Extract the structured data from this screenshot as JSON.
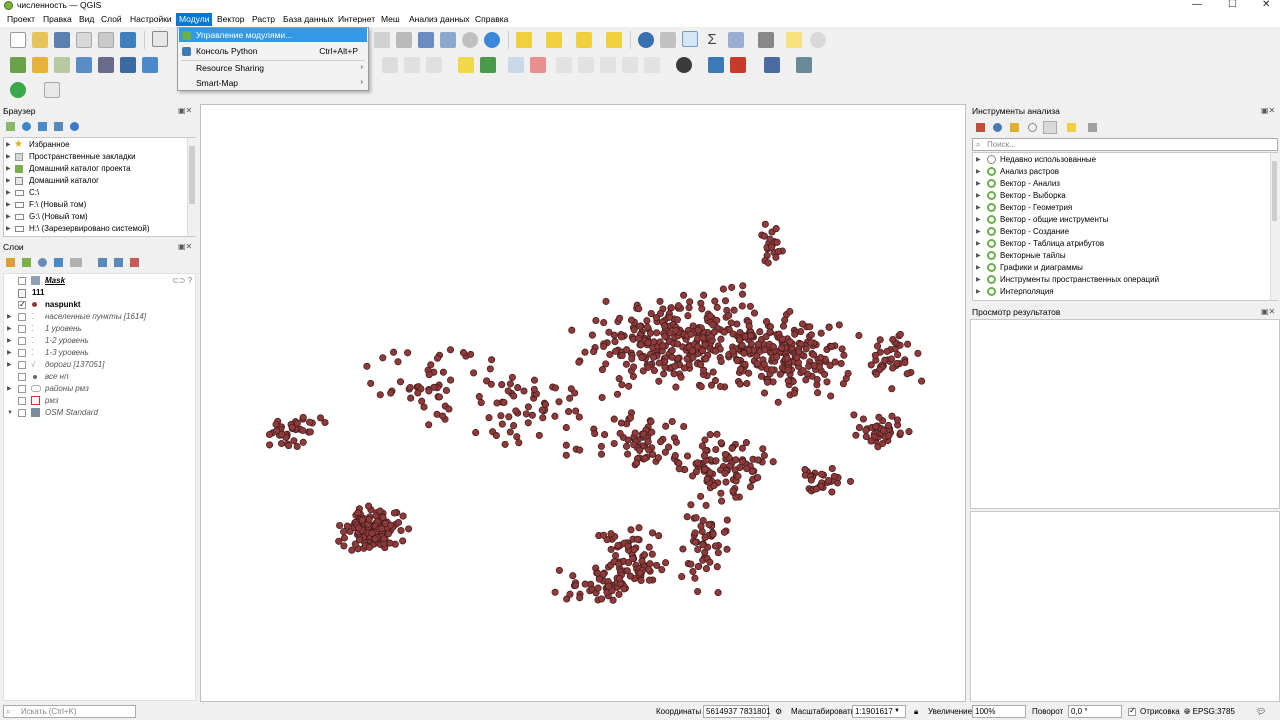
{
  "window": {
    "title": "численность — QGIS",
    "controls": [
      "—",
      "☐",
      "✕"
    ]
  },
  "menubar": {
    "items": [
      "Проект",
      "Правка",
      "Вид",
      "Слой",
      "Настройки",
      "Модули",
      "Вектор",
      "Растр",
      "База данных",
      "Интернет",
      "Меш",
      "Анализ данных",
      "Справка"
    ],
    "active": "Модули"
  },
  "plugins_menu": {
    "items": [
      {
        "label": "Управление модулями...",
        "shortcut": "",
        "submenu": false,
        "highlighted": true
      },
      {
        "label": "Консоль Python",
        "shortcut": "Ctrl+Alt+P",
        "submenu": false,
        "highlighted": false
      },
      {
        "label": "Resource Sharing",
        "shortcut": "",
        "submenu": true,
        "highlighted": false
      },
      {
        "label": "Smart-Map",
        "shortcut": "",
        "submenu": true,
        "highlighted": false
      }
    ]
  },
  "browser": {
    "title": "Браузер",
    "items": [
      "Избранное",
      "Пространственные закладки",
      "Домашний каталог проекта",
      "Домашний каталог",
      "C:\\",
      "F:\\ (Новый том)",
      "G:\\ (Новый том)",
      "H:\\ (Зарезервировано системой)"
    ]
  },
  "layers": {
    "title": "Слои",
    "items": [
      {
        "label": "Mask",
        "checked": false
      },
      {
        "label": "111",
        "checked": false
      },
      {
        "label": "naspunkt",
        "checked": true
      },
      {
        "label": "населенные пункты [1614]",
        "checked": false
      },
      {
        "label": "1 уровень",
        "checked": false
      },
      {
        "label": "1-2 уровень",
        "checked": false
      },
      {
        "label": "1-3 уровень",
        "checked": false
      },
      {
        "label": "дороги [137051]",
        "checked": false
      },
      {
        "label": "все нп",
        "checked": false
      },
      {
        "label": "районы рмз",
        "checked": false
      },
      {
        "label": "рмз",
        "checked": false
      },
      {
        "label": "OSM Standard",
        "checked": false
      }
    ]
  },
  "toolbox": {
    "title": "Инструменты анализа",
    "search_placeholder": "Поиск...",
    "items": [
      "Недавно использованные",
      "Анализ растров",
      "Вектор - Анализ",
      "Вектор - Выборка",
      "Вектор - Геометрия",
      "Вектор - общие инструменты",
      "Вектор - Создание",
      "Вектор - Таблица атрибутов",
      "Векторные тайлы",
      "Графики и диаграммы",
      "Инструменты пространственных операций",
      "Интерполяция"
    ]
  },
  "results": {
    "title": "Просмотр результатов"
  },
  "statusbar": {
    "search_placeholder": "Искать (Ctrl+K)",
    "coords_label": "Координаты",
    "coords_value": "5614937 7831801",
    "scale_label": "Масштабировать",
    "scale_value": "1:1901617",
    "magnifier_label": "Увеличение",
    "magnifier_value": "100%",
    "rotation_label": "Поворот",
    "rotation_value": "0,0 °",
    "render_label": "Отрисовка",
    "crs": "EPSG:3785"
  },
  "colors": {
    "point_fill": "#8f3a3a",
    "point_stroke": "#3d1a1a",
    "menu_active": "#0078d7",
    "menu_highlight": "#3399e6"
  }
}
